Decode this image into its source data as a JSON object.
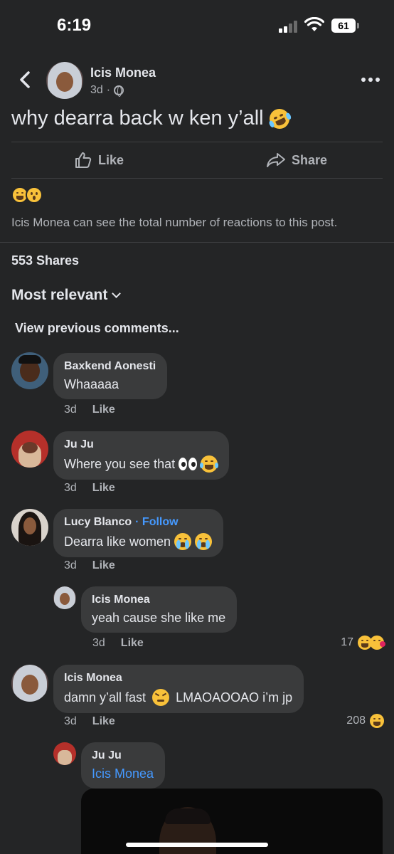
{
  "status_bar": {
    "time": "6:19",
    "battery": "61"
  },
  "post": {
    "author": "Icis Monea",
    "age": "3d",
    "separator": "·",
    "text": "why dearra back w ken y’all",
    "like_label": "Like",
    "share_label": "Share",
    "reaction_note": "Icis Monea can see the total number of reactions to this post.",
    "shares": "553 Shares"
  },
  "comments_section": {
    "sort_label": "Most relevant",
    "view_previous": "View previous comments..."
  },
  "comments": [
    {
      "name": "Baxkend Aonesti",
      "text": "Whaaaaa",
      "age": "3d",
      "like": "Like"
    },
    {
      "name": "Ju Ju",
      "text": "Where you see that",
      "age": "3d",
      "like": "Like"
    },
    {
      "name": "Lucy Blanco",
      "follow": "· Follow",
      "text": "Dearra like women",
      "age": "3d",
      "like": "Like"
    },
    {
      "name": "Icis Monea",
      "text": "yeah cause she like me",
      "age": "3d",
      "like": "Like",
      "reaction_count": "17"
    },
    {
      "name": "Icis Monea",
      "text": "damn y’all fast",
      "text2": "LMAOAOOAO i’m jp",
      "age": "3d",
      "like": "Like",
      "reaction_count": "208"
    },
    {
      "name": "Ju Ju",
      "text": "Icis Monea"
    }
  ]
}
